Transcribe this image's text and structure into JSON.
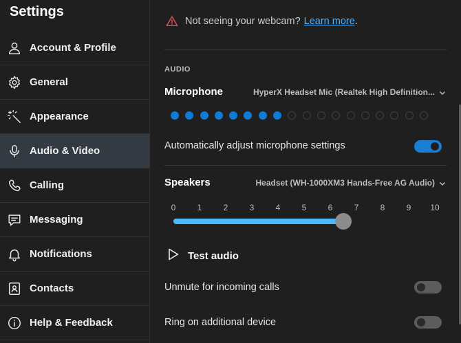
{
  "sidebar": {
    "title": "Settings",
    "items": [
      {
        "label": "Account & Profile",
        "icon": "person-icon",
        "active": false
      },
      {
        "label": "General",
        "icon": "gear-icon",
        "active": false
      },
      {
        "label": "Appearance",
        "icon": "magic-wand-icon",
        "active": false
      },
      {
        "label": "Audio & Video",
        "icon": "microphone-icon",
        "active": true
      },
      {
        "label": "Calling",
        "icon": "phone-icon",
        "active": false
      },
      {
        "label": "Messaging",
        "icon": "chat-icon",
        "active": false
      },
      {
        "label": "Notifications",
        "icon": "bell-icon",
        "active": false
      },
      {
        "label": "Contacts",
        "icon": "contact-card-icon",
        "active": false
      },
      {
        "label": "Help & Feedback",
        "icon": "info-icon",
        "active": false
      }
    ]
  },
  "webcam_notice": {
    "text": "Not seeing your webcam?",
    "link": "Learn more",
    "period": "."
  },
  "audio": {
    "section_heading": "AUDIO",
    "microphone": {
      "label": "Microphone",
      "device": "HyperX Headset Mic (Realtek High Definition...",
      "level_active": 8,
      "level_total": 18
    },
    "auto_adjust": {
      "label": "Automatically adjust microphone settings",
      "on": true
    },
    "speakers": {
      "label": "Speakers",
      "device": "Headset (WH-1000XM3 Hands-Free AG Audio)",
      "volume_ticks": [
        "0",
        "1",
        "2",
        "3",
        "4",
        "5",
        "6",
        "7",
        "8",
        "9",
        "10"
      ],
      "volume_value": 6.5
    },
    "test_audio": "Test audio",
    "unmute_incoming": {
      "label": "Unmute for incoming calls",
      "on": false
    },
    "ring_additional": {
      "label": "Ring on additional device",
      "on": false
    }
  },
  "colors": {
    "accent": "#1a7fd4",
    "link": "#4db2ff",
    "warning": "#e0514b",
    "slider_fill": "#4db8ff"
  }
}
